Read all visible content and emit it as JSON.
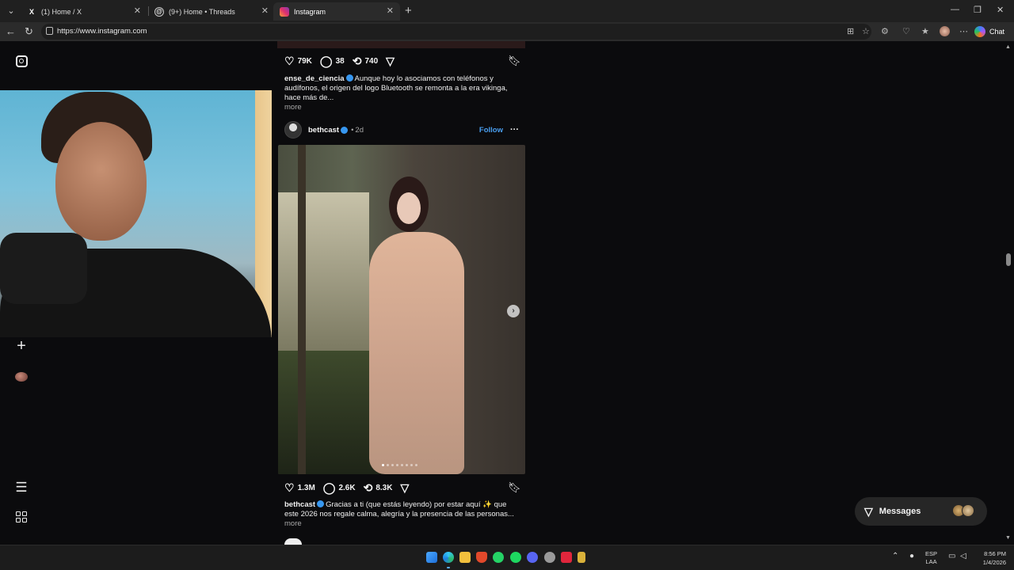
{
  "browser": {
    "tabs": [
      {
        "label": "(1) Home / X",
        "icon": "x-logo-icon",
        "active": false
      },
      {
        "label": "(9+) Home • Threads",
        "icon": "threads-logo-icon",
        "active": false
      },
      {
        "label": "Instagram",
        "icon": "instagram-logo-icon",
        "active": true
      }
    ],
    "url": "https://www.instagram.com",
    "chat_label": "Chat"
  },
  "feed": {
    "prev_post": {
      "likes": "79K",
      "comments": "38",
      "reposts": "740",
      "caption_user": "ense_de_ciencia",
      "caption_text": "Aunque hoy lo asociamos con teléfonos y audífonos, el origen del logo Bluetooth se remonta a la era vikinga, hace más de...",
      "more_label": "more"
    },
    "post": {
      "username": "bethcast",
      "separator": "•",
      "time": "2d",
      "follow_label": "Follow",
      "likes": "1.3M",
      "comments": "2.6K",
      "reposts": "8.3K",
      "caption_user": "bethcast",
      "caption_text": "Gracias a ti (que estás leyendo) por estar aquí ✨ que este 2026 nos regale calma, alegría y la presencia de las personas...",
      "more_label": "more",
      "carousel_count": 8,
      "carousel_index": 1
    }
  },
  "messages": {
    "label": "Messages"
  },
  "taskbar": {
    "lang_line1": "ESP",
    "lang_line2": "LAA",
    "time": "8:56 PM",
    "date": "1/4/2026"
  }
}
